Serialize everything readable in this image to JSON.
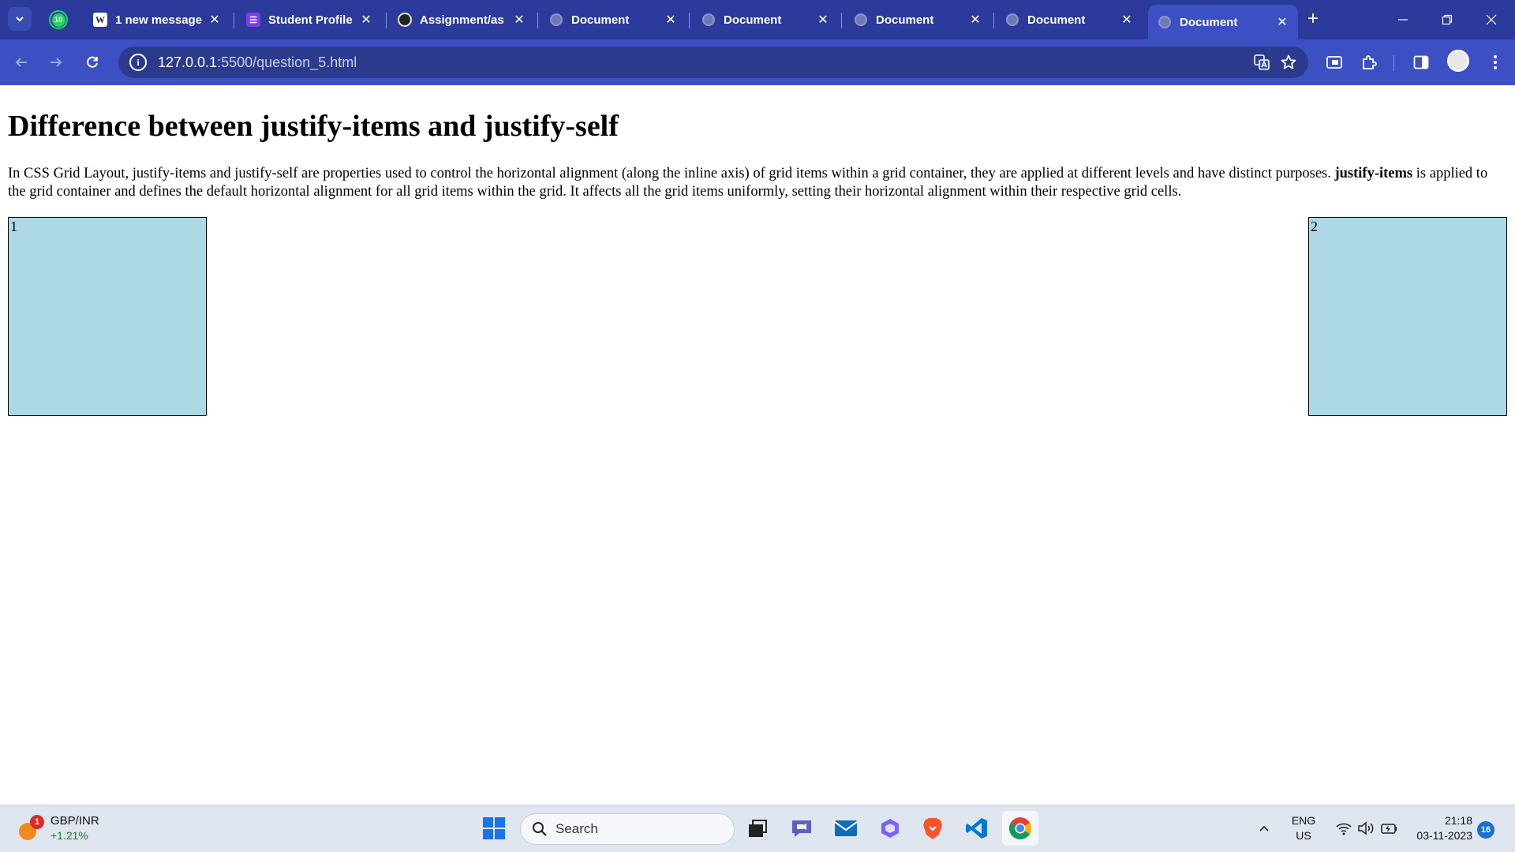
{
  "browser": {
    "tabs": [
      {
        "label": "1 new message",
        "favicon": "wordpress-icon"
      },
      {
        "label": "Student Profile",
        "favicon": "list-icon"
      },
      {
        "label": "Assignment/as",
        "favicon": "github-icon"
      },
      {
        "label": "Document",
        "favicon": "globe-icon"
      },
      {
        "label": "Document",
        "favicon": "globe-icon"
      },
      {
        "label": "Document",
        "favicon": "globe-icon"
      },
      {
        "label": "Document",
        "favicon": "globe-icon"
      },
      {
        "label": "Document",
        "favicon": "globe-icon",
        "active": true
      }
    ],
    "whatsapp_badge": "10",
    "url_host": "127.0.0.1",
    "url_path": ":5500/question_5.html",
    "info_glyph": "i"
  },
  "page": {
    "heading": "Difference between justify-items and justify-self",
    "paragraph_intro": "In CSS Grid Layout, justify-items and justify-self are properties used to control the horizontal alignment (along the inline axis) of grid items within a grid container, they are applied at different levels and have distinct purposes. ",
    "paragraph_bold": "justify-items",
    "paragraph_rest": " is applied to the grid container and defines the default horizontal alignment for all grid items within the grid. It affects all the grid items uniformly, setting their horizontal alignment within their respective grid cells.",
    "grid_items": [
      "1",
      "2"
    ],
    "grid_item_color": "#add8e6"
  },
  "taskbar": {
    "widget_title": "GBP/INR",
    "widget_change": "+1.21%",
    "widget_badge": "1",
    "search_label": "Search",
    "lang_primary": "ENG",
    "lang_secondary": "US",
    "time": "21:18",
    "date": "03-11-2023",
    "notification_count": "16"
  },
  "colors": {
    "tabstrip": "#2b3a9b",
    "toolbar": "#3c50c4",
    "taskbar": "#dfe6ef"
  }
}
